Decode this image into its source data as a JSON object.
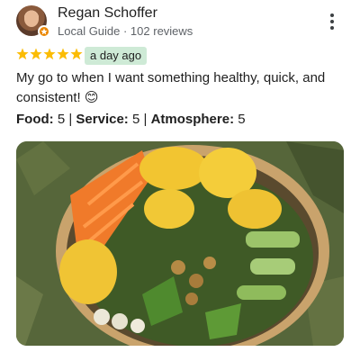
{
  "reviewer": {
    "name": "Regan Schoffer",
    "subtitle": "Local Guide · 102 reviews",
    "avatar_icon": "user-avatar",
    "badge_icon": "local-guide-star-icon",
    "badge_color": "#ea8600"
  },
  "rating": {
    "stars": 5,
    "max_stars": 5,
    "star_color": "#fbbc04",
    "time": "a day ago",
    "time_badge_color": "#ceead6"
  },
  "review": {
    "text": "My go to when I want something healthy, quick, and consistent! 😊"
  },
  "scores": {
    "food_label": "Food:",
    "food_value": "5",
    "service_label": "Service:",
    "service_value": "5",
    "atmosphere_label": "Atmosphere:",
    "atmosphere_value": "5",
    "separator": "|"
  },
  "menu": {
    "icon": "more-vert-icon"
  },
  "photo": {
    "icon": "food-bowl-photo"
  }
}
